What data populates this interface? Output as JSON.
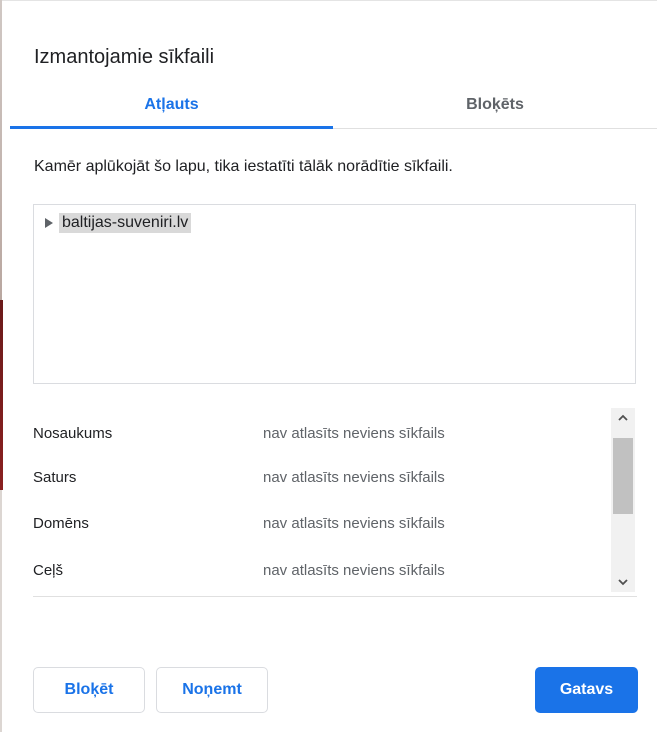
{
  "dialog": {
    "title": "Izmantojamie sīkfaili",
    "tabs": [
      {
        "label": "Atļauts",
        "active": true
      },
      {
        "label": "Bloķēts",
        "active": false
      }
    ],
    "description": "Kamēr aplūkojāt šo lapu, tika iestatīti tālāk norādītie sīkfaili.",
    "tree": {
      "items": [
        {
          "label": "baltijas-suveniri.lv",
          "icon": "triangle-right-icon",
          "selected": true
        }
      ]
    },
    "details": [
      {
        "key": "Nosaukums",
        "value": "nav atlasīts neviens sīkfails"
      },
      {
        "key": "Saturs",
        "value": "nav atlasīts neviens sīkfails"
      },
      {
        "key": "Domēns",
        "value": "nav atlasīts neviens sīkfails"
      },
      {
        "key": "Ceļš",
        "value": "nav atlasīts neviens sīkfails"
      }
    ],
    "buttons": {
      "block": "Bloķēt",
      "remove": "Noņemt",
      "done": "Gatavs"
    }
  },
  "colors": {
    "accent": "#1a73e8",
    "text": "#202124",
    "muted": "#5f6368",
    "selection": "#d9d9d9"
  }
}
